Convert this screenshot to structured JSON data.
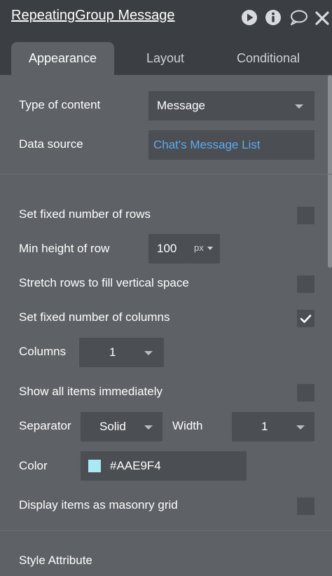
{
  "header": {
    "title": "RepeatingGroup Message",
    "icons": [
      "play-icon",
      "info-icon",
      "comment-icon",
      "close-icon"
    ]
  },
  "tabs": [
    {
      "label": "Appearance",
      "active": true
    },
    {
      "label": "Layout",
      "active": false
    },
    {
      "label": "Conditional",
      "active": false
    }
  ],
  "content": {
    "type_label": "Type of content",
    "type_value": "Message",
    "source_label": "Data source",
    "source_value": "Chat's Message List"
  },
  "rows": {
    "fixed_rows_label": "Set fixed number of rows",
    "fixed_rows_checked": false,
    "min_height_label": "Min height of row",
    "min_height_value": "100",
    "min_height_unit": "px",
    "stretch_label": "Stretch rows to fill vertical space",
    "stretch_checked": false,
    "fixed_cols_label": "Set fixed number of columns",
    "fixed_cols_checked": true,
    "columns_label": "Columns",
    "columns_value": "1",
    "show_all_label": "Show all items immediately",
    "show_all_checked": false
  },
  "separator": {
    "label": "Separator",
    "style_value": "Solid",
    "width_label": "Width",
    "width_value": "1",
    "color_label": "Color",
    "color_value": "#AAE9F4",
    "color_hex": "#AAE9F4"
  },
  "masonry": {
    "label": "Display items as masonry grid",
    "checked": false
  },
  "style": {
    "label": "Style Attribute"
  },
  "colors": {
    "panel": "#5e6266",
    "header": "#3b3e42",
    "field": "#4b4f53",
    "link": "#5ea9f0"
  }
}
